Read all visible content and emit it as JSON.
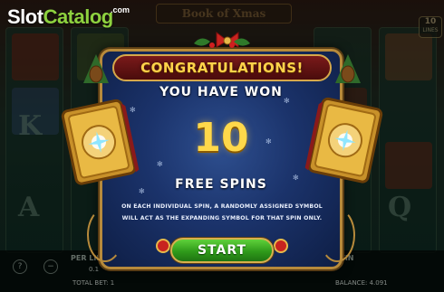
{
  "logo": {
    "slot": "Slot",
    "catalog": "Catalog",
    "com": ".com"
  },
  "game": {
    "title": "Book of Xmas",
    "badge_top": "10",
    "badge_bottom": "LINES"
  },
  "reels_bg": {
    "letters": [
      "K",
      "A",
      "Q"
    ]
  },
  "bottom_bar": {
    "per_line_label": "PER LINE",
    "per_line_value": "0.1",
    "total_bet_label": "TOTAL BET: 1",
    "win_label": "WIN",
    "balance_label": "BALANCE: 4.091",
    "help_icon": "question-icon",
    "minus_icon": "minus-icon"
  },
  "popup": {
    "banner": "CONGRATULATIONS!",
    "won_text": "YOU HAVE WON",
    "count": "10",
    "free_spins": "FREE SPINS",
    "description_line1": "ON EACH INDIVIDUAL SPIN, A RANDOMLY ASSIGNED SYMBOL",
    "description_line2": "WILL ACT AS THE EXPANDING SYMBOL FOR THAT SPIN ONLY.",
    "start_label": "START"
  },
  "colors": {
    "gold": "#ffd84a",
    "banner_red": "#7a1a1a",
    "start_green": "#2f9a1a",
    "popup_blue": "#1b336b",
    "frame_gold": "#b78a3b"
  }
}
